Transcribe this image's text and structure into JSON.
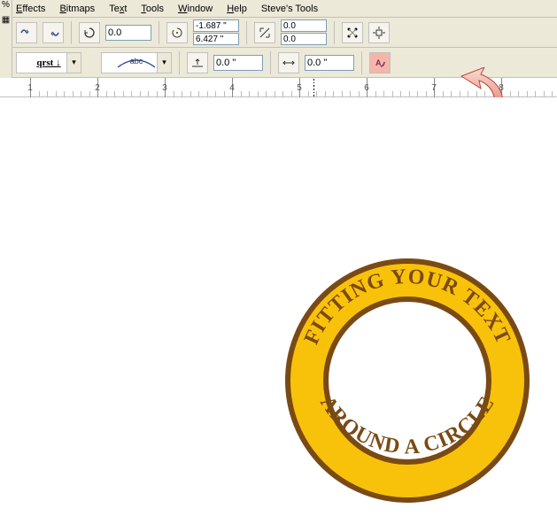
{
  "menu": {
    "effects": "Effects",
    "bitmaps": "Bitmaps",
    "text": "Text",
    "tools": "Tools",
    "window": "Window",
    "help": "Help",
    "steves_tools": "Steve's Tools"
  },
  "toolbar1": {
    "rotation": "0.0",
    "posx": "-1.687 \"",
    "posy": "6.427 \"",
    "sizex": "0.0",
    "sizey": "0.0"
  },
  "toolbar2": {
    "preset1": "qrst ↓",
    "preset2": "abc",
    "distance_from_path": "0.0 \"",
    "horizontal_offset": "0.0 \""
  },
  "ruler": {
    "ticks": [
      "1",
      "2",
      "3",
      "4",
      "5",
      "6",
      "7",
      "8"
    ]
  },
  "artwork": {
    "top_text": "FITTING YOUR TEXT",
    "bottom_text": "AROUND A CIRCLE"
  },
  "colors": {
    "ring_fill": "#f9c20a",
    "ring_stroke": "#7a4a14",
    "text_color": "#7a4a14"
  }
}
